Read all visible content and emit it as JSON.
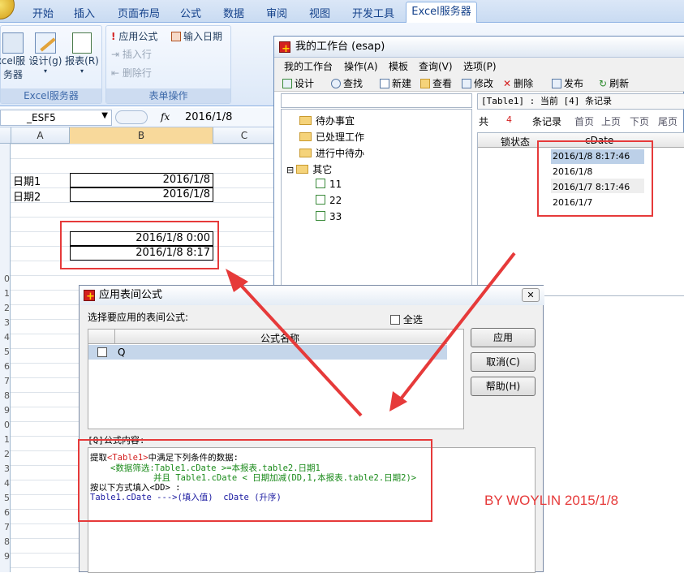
{
  "ribbon": {
    "tabs": [
      "开始",
      "插入",
      "页面布局",
      "公式",
      "数据",
      "审阅",
      "视图",
      "开发工具"
    ],
    "active_tab": "Excel服务器",
    "group1": {
      "btn1_line1": "xcel服",
      "btn1_line2": "务器",
      "btn2": "设计(g)",
      "btn3": "报表(R)",
      "label": "Excel服务器"
    },
    "group2": {
      "apply_formula": "应用公式",
      "input_date": "输入日期",
      "insert_row": "插入行",
      "delete_row": "删除行",
      "label": "表单操作"
    }
  },
  "formula_bar": {
    "name_box": "_ESF5",
    "fx": "fx",
    "value": "2016/1/8"
  },
  "sheet": {
    "columns": [
      "A",
      "B",
      "C"
    ],
    "rows": [
      {
        "label": "日期1",
        "value": "2016/1/8"
      },
      {
        "label": "日期2",
        "value": "2016/1/8"
      }
    ],
    "results": [
      "2016/1/8 0:00",
      "2016/1/8 8:17"
    ],
    "row_numbers": [
      "0",
      "1",
      "2",
      "3",
      "4",
      "5",
      "6",
      "7",
      "8",
      "9",
      "0",
      "1",
      "2",
      "3",
      "4",
      "5",
      "6",
      "7",
      "8",
      "9"
    ]
  },
  "workspace": {
    "title": "我的工作台 (esap)",
    "menu": [
      "我的工作台",
      "操作(A)",
      "模板",
      "查询(V)",
      "选项(P)"
    ],
    "toolbar": [
      "设计",
      "查找",
      "新建",
      "查看",
      "修改",
      "删除",
      "发布",
      "刷新"
    ],
    "tree": [
      "待办事宜",
      "已处理工作",
      "进行中待办",
      "其它"
    ],
    "tree_children": [
      "11",
      "22",
      "33"
    ],
    "expander": "⊟",
    "record_header": "[Table1] : 当前 [4] 条记录",
    "pager": {
      "total_prefix": "共",
      "total": "4",
      "total_suffix": "条记录",
      "first": "首页",
      "prev": "上页",
      "next": "下页",
      "last": "尾页"
    },
    "grid_headers": [
      "锁状态",
      "cDate"
    ],
    "grid_rows": [
      "2016/1/8 8:17:46",
      "2016/1/8",
      "2016/1/7 8:17:46",
      "2016/1/7"
    ]
  },
  "dialog": {
    "title": "应用表间公式",
    "prompt": "选择要应用的表间公式:",
    "select_all": "全选",
    "column_header": "公式名称",
    "formula_row": "Q",
    "apply": "应用",
    "cancel": "取消(C)",
    "help": "帮助(H)",
    "content_label": "[Q]公式内容:",
    "content": {
      "l1_prefix": "提取",
      "l1_table": "<Table1>",
      "l1_suffix": "中满足下列条件的数据:",
      "l2": "<数据筛选:Table1.cDate   >=本报表.table2.日期1",
      "l3": "并且 Table1.cDate   < 日期加减(DD,1,本报表.table2.日期2)>",
      "l4": "按以下方式填入<DD> :",
      "l5_a": "Table1.cDate  --->(填入值)",
      "l5_b": "cDate (升序)"
    }
  },
  "watermark": "BY WOYLIN 2015/1/8",
  "colors": {
    "annotation_red": "#e63a3a",
    "formula_green": "#1a8a1a",
    "formula_blue": "#1a1aa0"
  }
}
